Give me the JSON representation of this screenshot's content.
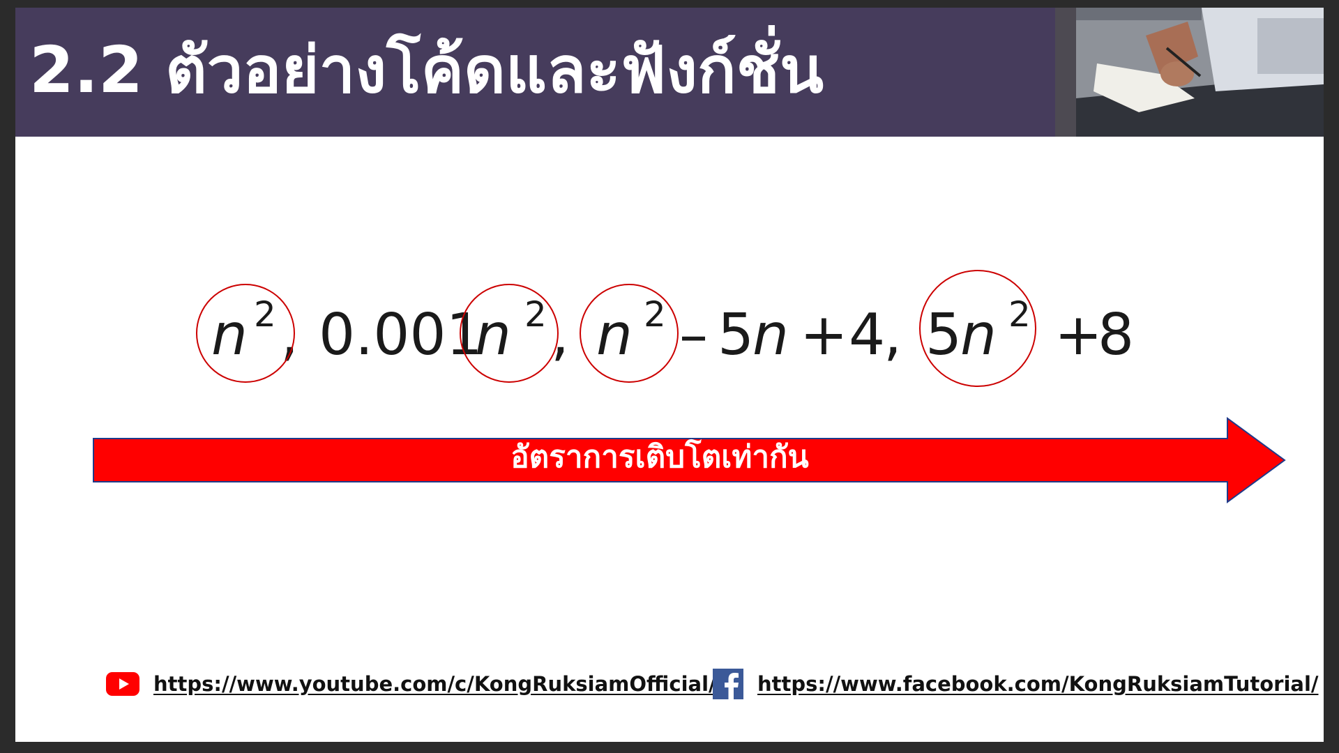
{
  "title": "2.2 ตัวอย่างโค้ดและฟังก์ชั่น",
  "expression": {
    "variable": "n",
    "exponent": "2",
    "comma": ",",
    "coef": "0.001",
    "minus": "–",
    "five": "5",
    "plus": "+",
    "four": "4",
    "eight": "8"
  },
  "arrow_label": "อัตราการเติบโตเท่ากัน",
  "links": {
    "youtube": "https://www.youtube.com/c/KongRuksiamOfficial/",
    "facebook": "https://www.facebook.com/KongRuksiamTutorial/"
  },
  "icons": {
    "youtube": "youtube-icon",
    "facebook": "facebook-icon"
  },
  "colors": {
    "header_bg": "#463c5c",
    "accent_red": "#ff0000",
    "circle_stroke": "#cc0000",
    "arrow_outline": "#1e3a8a",
    "facebook_blue": "#3b5998",
    "youtube_red": "#ff0000"
  }
}
